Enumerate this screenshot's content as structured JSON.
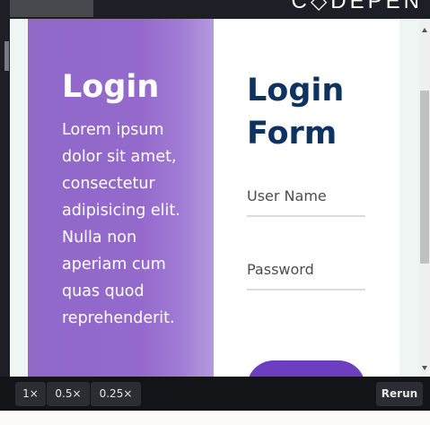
{
  "header": {
    "brand": "C◇DEPEN",
    "tab_label": ""
  },
  "card": {
    "left": {
      "title": "Login",
      "description": "Lorem ipsum dolor sit amet, consectetur adipisicing elit. Nulla non aperiam cum quas quod reprehenderit."
    },
    "right": {
      "title": "Login Form",
      "username_placeholder": "User Name",
      "password_placeholder": "Password",
      "submit_label": ""
    }
  },
  "toolbar": {
    "zoom_options": [
      "1×",
      "0.5×",
      "0.25×"
    ],
    "rerun_label": "Rerun"
  },
  "colors": {
    "panel_purple": "#9069c9",
    "title_navy": "#0e3361",
    "button_purple": "#6e3ec0",
    "bar_dark": "#1e1f26"
  },
  "icons": [
    "scroll-up-icon",
    "scroll-down-icon"
  ]
}
